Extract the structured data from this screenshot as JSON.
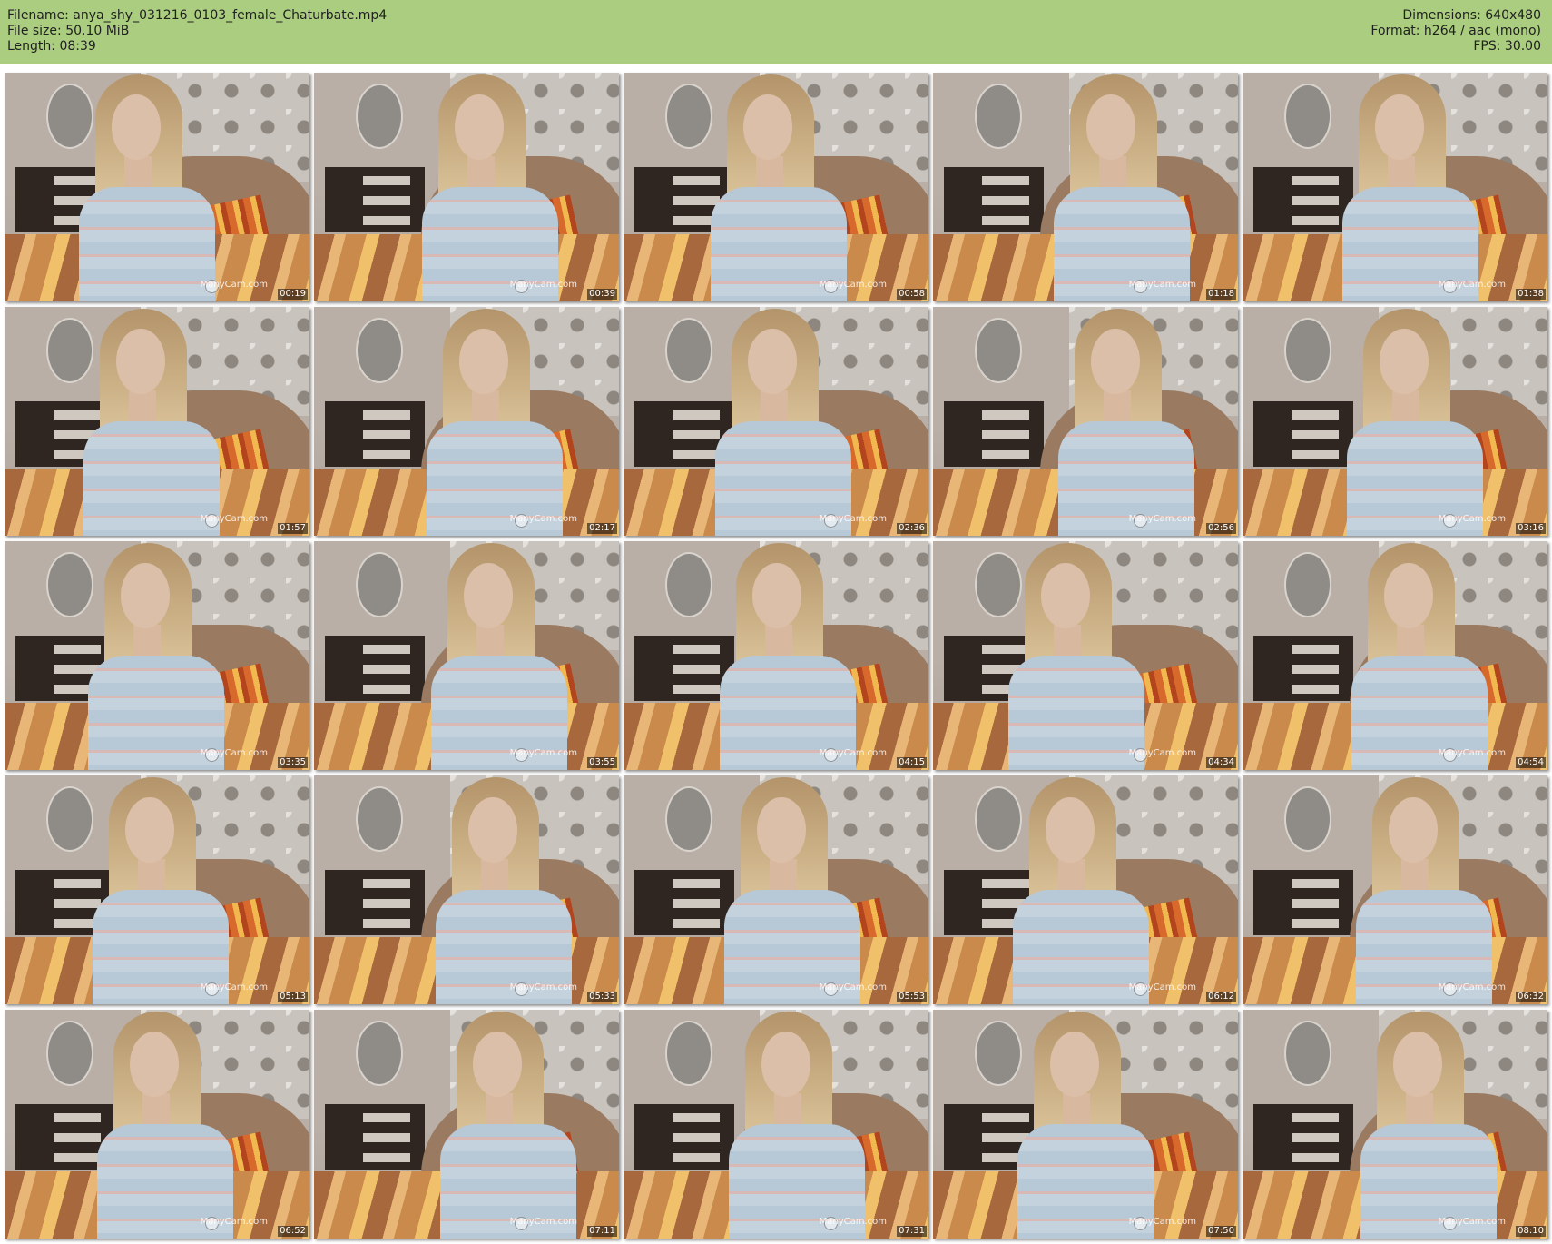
{
  "header": {
    "filename": "Filename: anya_shy_031216_0103_female_Chaturbate.mp4",
    "filesize": "File size: 50.10 MiB",
    "length": "Length: 08:39",
    "dimensions": "Dimensions: 640x480",
    "format": "Format: h264 / aac (mono)",
    "fps": "FPS: 30.00",
    "background_color": "#abcd7f"
  },
  "thumbnails": {
    "watermark": "ManyCam.com",
    "timestamps": [
      "00:19",
      "00:39",
      "00:58",
      "01:18",
      "01:38",
      "01:57",
      "02:17",
      "02:36",
      "02:56",
      "03:16",
      "03:35",
      "03:55",
      "04:15",
      "04:34",
      "04:54",
      "05:13",
      "05:33",
      "05:53",
      "06:12",
      "06:32",
      "06:52",
      "07:11",
      "07:31",
      "07:50",
      "08:10"
    ]
  }
}
